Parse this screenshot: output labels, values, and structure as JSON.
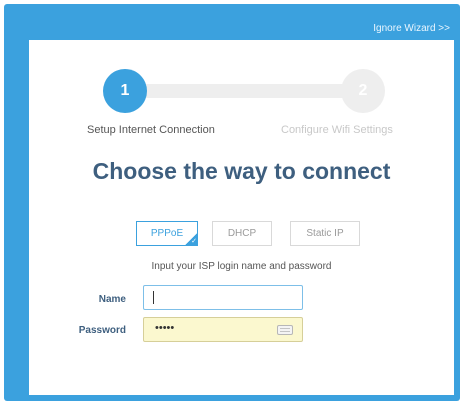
{
  "header": {
    "ignore_link": "Ignore Wizard >>"
  },
  "steps": [
    {
      "number": "1",
      "label": "Setup Internet Connection",
      "active": true
    },
    {
      "number": "2",
      "label": "Configure Wifi Settings",
      "active": false
    }
  ],
  "main": {
    "heading": "Choose the way to connect",
    "connection_types": [
      {
        "label": "PPPoE",
        "selected": true
      },
      {
        "label": "DHCP",
        "selected": false
      },
      {
        "label": "Static IP",
        "selected": false
      }
    ],
    "hint": "Input your ISP login name and password"
  },
  "form": {
    "name": {
      "label": "Name",
      "value": ""
    },
    "password": {
      "label": "Password",
      "value": "•••••"
    }
  },
  "colors": {
    "accent": "#3ba1de",
    "heading": "#3e5f7f",
    "password_fill": "#fbf8cf"
  }
}
